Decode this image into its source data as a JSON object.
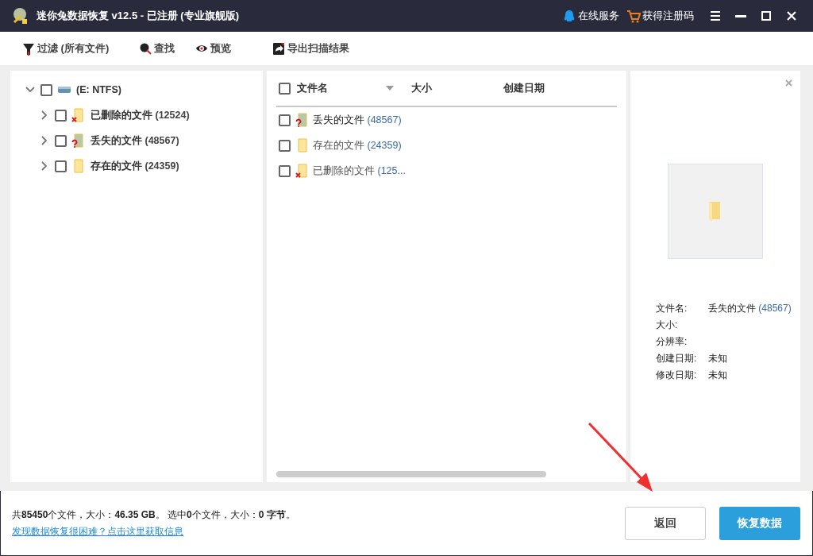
{
  "window": {
    "title": "迷你兔数据恢复 v12.5 - 已注册 (专业旗舰版)"
  },
  "title_bar_links": [
    {
      "kind": "service",
      "label": "在线服务"
    },
    {
      "kind": "register",
      "label": "获得注册码"
    }
  ],
  "toolbar": [
    {
      "kind": "filter",
      "label": "过滤 (所有文件)"
    },
    {
      "kind": "search",
      "label": "查找"
    },
    {
      "kind": "preview",
      "label": "预览"
    },
    {
      "kind": "export",
      "label": "导出扫描结果"
    }
  ],
  "tree": {
    "label": "(E: NTFS)",
    "checked": false,
    "expanded": true,
    "children": [
      {
        "kind": "deleted",
        "name": "已删除的文件",
        "count": "(12524)",
        "checked": false,
        "expanded": false
      },
      {
        "kind": "lost",
        "name": "丢失的文件",
        "count": "(48567)",
        "checked": false,
        "expanded": false
      },
      {
        "kind": "existing",
        "name": "存在的文件",
        "count": "(24359)",
        "checked": false,
        "expanded": false
      }
    ]
  },
  "file_list": {
    "select_all_checked": false,
    "columns": [
      "文件名",
      "大小",
      "创建日期"
    ],
    "rows": [
      {
        "kind": "lost",
        "name": "丢失的文件",
        "count": "(48567)",
        "checked": false,
        "selected": true
      },
      {
        "kind": "existing",
        "name": "存在的文件",
        "count": "(24359)",
        "checked": false,
        "selected": false
      },
      {
        "kind": "deleted",
        "name": "已删除的文件",
        "count": "(125...",
        "checked": false,
        "selected": false
      }
    ]
  },
  "preview": {
    "details": [
      {
        "label": "文件名:",
        "name": "丢失的文件",
        "count": "(48567)"
      },
      {
        "label": "大小:"
      },
      {
        "label": "分辨率:"
      },
      {
        "label": "创建日期:",
        "value": "未知"
      },
      {
        "label": "修改日期:",
        "value": "未知"
      }
    ]
  },
  "footer": {
    "summary": "共**85450**个文件，大小：**46.35 GB**。 选中**0**个文件，大小：**0 字节**。",
    "help_link": "发现数据恢复很困难？点击这里获取信息",
    "buttons": [
      {
        "kind": "secondary",
        "label": "返回"
      },
      {
        "kind": "primary",
        "label": "恢复数据"
      }
    ]
  }
}
